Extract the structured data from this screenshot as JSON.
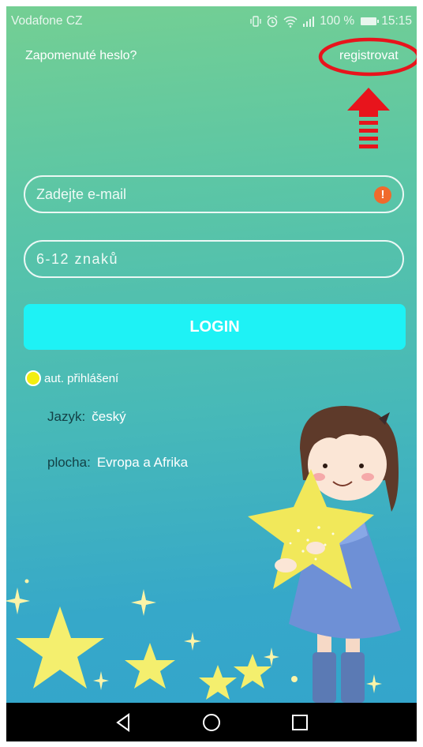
{
  "status_bar": {
    "carrier": "Vodafone CZ",
    "battery": "100 %",
    "time": "15:15",
    "icons": [
      "vibrate-icon",
      "alarm-icon",
      "wifi-icon",
      "signal-icon",
      "battery-icon"
    ]
  },
  "header": {
    "forgot_password": "Zapomenuté heslo?",
    "register": "registrovat"
  },
  "form": {
    "email_placeholder": "Zadejte e-mail",
    "email_warning": "!",
    "password_placeholder": "6-12 znaků",
    "login_label": "LOGIN",
    "auto_login_label": "aut. přihlášení"
  },
  "settings": {
    "language_label": "Jazyk:",
    "language_value": "český",
    "region_label": "plocha:",
    "region_value": "Evropa a Afrika"
  },
  "nav_bar": {
    "icons": [
      "back-icon",
      "home-icon",
      "recents-icon"
    ]
  },
  "colors": {
    "login_button": "#1ef2f5",
    "warning": "#f06a2c",
    "annotation": "#e8141c",
    "radio": "#f2ee10"
  }
}
